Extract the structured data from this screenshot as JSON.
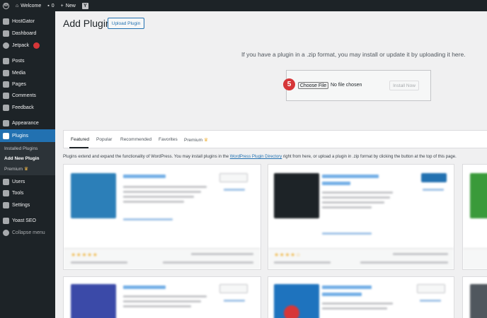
{
  "adminbar": {
    "site_name": "Welcome",
    "comments_count": "0",
    "new_label": "New"
  },
  "sidebar": {
    "items": [
      {
        "label": "HostGator"
      },
      {
        "label": "Dashboard"
      },
      {
        "label": "Jetpack"
      },
      {
        "label": "Posts"
      },
      {
        "label": "Media"
      },
      {
        "label": "Pages"
      },
      {
        "label": "Comments"
      },
      {
        "label": "Feedback"
      },
      {
        "label": "Appearance"
      },
      {
        "label": "Plugins"
      },
      {
        "label": "Users"
      },
      {
        "label": "Tools"
      },
      {
        "label": "Settings"
      },
      {
        "label": "Yoast SEO"
      },
      {
        "label": "Collapse menu"
      }
    ],
    "submenu": [
      {
        "label": "Installed Plugins"
      },
      {
        "label": "Add New Plugin"
      },
      {
        "label": "Premium"
      }
    ]
  },
  "page": {
    "title": "Add Plugins",
    "upload_button": "Upload Plugin",
    "upload_text": "If you have a plugin in a .zip format, you may install or update it by uploading it here.",
    "step_number": "5",
    "choose_file": "Choose File",
    "no_file": "No file chosen",
    "install_now": "Install Now"
  },
  "filter_tabs": [
    {
      "label": "Featured"
    },
    {
      "label": "Popular"
    },
    {
      "label": "Recommended"
    },
    {
      "label": "Favorites"
    },
    {
      "label": "Premium"
    }
  ],
  "intro": {
    "before": "Plugins extend and expand the functionality of WordPress. You may install plugins in the ",
    "link": "WordPress Plugin Directory",
    "after": " right from here, or upload a plugin in .zip format by clicking the button at the top of this page."
  },
  "colors": {
    "admin_dark": "#1d2327",
    "accent": "#2271b1",
    "step_badge": "#d63638",
    "premium_crown": "#f0b849"
  },
  "icons": [
    "wordpress-logo-icon",
    "home-icon",
    "comment-icon",
    "plus-icon",
    "yoast-icon",
    "crown-icon"
  ]
}
